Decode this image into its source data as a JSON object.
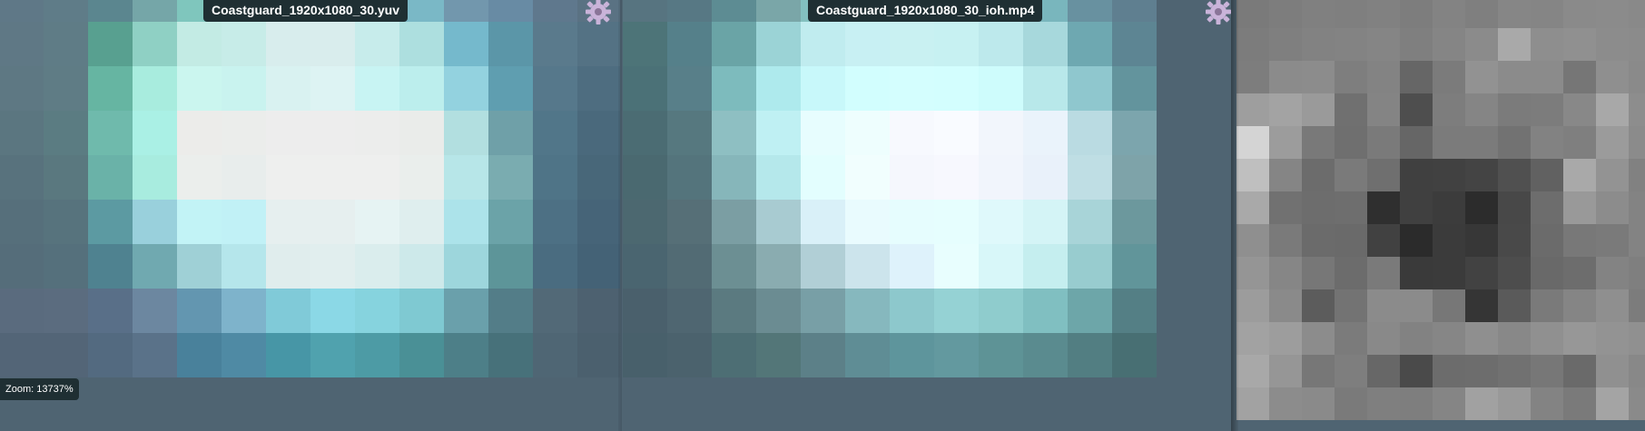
{
  "views": [
    {
      "title": "Coastguard_1920x1080_30.yuv",
      "rows": [
        [
          "#5f7887",
          "#5f7c88",
          "#5b868f",
          "#75a6a8",
          "#7fc6bd",
          "#8dd8cf",
          "#97dfdb",
          "#96dcdd",
          "#8bd1dc",
          "#7ab8c6",
          "#7297ad",
          "#688ba4",
          "#5f788d",
          "#5a7283"
        ],
        [
          "#5f7885",
          "#5f7c86",
          "#58a090",
          "#8fd0c4",
          "#c3ebe4",
          "#c7ece8",
          "#d8eded",
          "#d9eded",
          "#c7eceb",
          "#addfdf",
          "#75b9cc",
          "#5b96a8",
          "#5a7a8c",
          "#547284"
        ],
        [
          "#5e7883",
          "#5f7c85",
          "#66b5a2",
          "#a8ecde",
          "#cbf6ef",
          "#c9f3ef",
          "#d9f2f1",
          "#ddf3f3",
          "#c8f4f3",
          "#bceeed",
          "#93d2df",
          "#5f9eb0",
          "#56788b",
          "#4e6d80"
        ],
        [
          "#5b7680",
          "#5b7c82",
          "#6fbaac",
          "#aaf0e5",
          "#ececea",
          "#ebedeb",
          "#ededed",
          "#ededed",
          "#ecedec",
          "#eaecea",
          "#b2dfe0",
          "#6fa0a8",
          "#517689",
          "#4a697c"
        ],
        [
          "#58727d",
          "#5a787f",
          "#6ab2a8",
          "#a8ecdf",
          "#ebeeec",
          "#e8edec",
          "#eeefee",
          "#eeefee",
          "#eeefee",
          "#eaeeec",
          "#b7e6e8",
          "#7aacb0",
          "#4f7487",
          "#486779"
        ],
        [
          "#566f7b",
          "#57737d",
          "#5c9aa2",
          "#99d0dc",
          "#c2f3f6",
          "#c1f1f6",
          "#e6efef",
          "#e6efef",
          "#e6f3f3",
          "#dfeeee",
          "#ace3ea",
          "#6ba3a8",
          "#4d7084",
          "#466478"
        ],
        [
          "#556d7a",
          "#55707c",
          "#4f8290",
          "#70a9b0",
          "#9fd0d6",
          "#b5e6eb",
          "#e0eded",
          "#e1eeee",
          "#daeded",
          "#cde9ea",
          "#9dd6dc",
          "#5d9599",
          "#4a6c80",
          "#446276"
        ],
        [
          "#5a6b7e",
          "#5b6c7f",
          "#596f88",
          "#6c87a0",
          "#6396b0",
          "#7eb3cb",
          "#80cad8",
          "#8bd8e6",
          "#86d3de",
          "#7fc9d2",
          "#6aa0ab",
          "#537d88",
          "#526977",
          "#4d6170"
        ],
        [
          "#536577",
          "#536577",
          "#536a80",
          "#5a7289",
          "#49819b",
          "#4f8aa4",
          "#4796a6",
          "#50a2ae",
          "#4d9ba5",
          "#4a9096",
          "#4d7f88",
          "#47717a",
          "#4f6674",
          "#4b606e"
        ]
      ]
    },
    {
      "title": "Coastguard_1920x1080_30_ioh.mp4",
      "rows": [
        [
          "#577480",
          "#577884",
          "#5d8c93",
          "#7aa6a8",
          "#83c0c0",
          "#9edcdb",
          "#9ddedc",
          "#a1e0de",
          "#8ed3d2",
          "#79b6bd",
          "#6891a0",
          "#5f7f90"
        ],
        [
          "#4d7478",
          "#55808a",
          "#6aa4a6",
          "#9bd3d6",
          "#c0ecef",
          "#c8f0f3",
          "#c9f1f2",
          "#c7f1f2",
          "#bde9ec",
          "#a7d8dc",
          "#6ea8b1",
          "#5d8593"
        ],
        [
          "#4b7177",
          "#587f89",
          "#7dbbbd",
          "#aeeaed",
          "#c8f8fa",
          "#d2fefe",
          "#d4fefe",
          "#d3fefe",
          "#cefcfc",
          "#b8e8ea",
          "#8fc7ce",
          "#63949d"
        ],
        [
          "#4b6c73",
          "#56787f",
          "#8ebfc2",
          "#bff0f3",
          "#e7fdfe",
          "#eefefe",
          "#f7f9fe",
          "#f9fbff",
          "#f2f6fc",
          "#eaf3fb",
          "#badbe2",
          "#7ca5ad"
        ],
        [
          "#4a6970",
          "#54747c",
          "#86b6ba",
          "#b5e8eb",
          "#e3fefe",
          "#f1fefe",
          "#f5f7fd",
          "#f7f8fe",
          "#f1f5fc",
          "#e9f1fa",
          "#bfdee4",
          "#7ea3a9"
        ],
        [
          "#4c6870",
          "#566f77",
          "#7b9ea3",
          "#a8cbd1",
          "#d9f0f8",
          "#e9fbfe",
          "#e6fdfe",
          "#e6fefe",
          "#dff9fb",
          "#d4f4f6",
          "#a8d4d8",
          "#6c989d"
        ],
        [
          "#4a6570",
          "#526b74",
          "#6c8f93",
          "#8aacb0",
          "#b1cfd6",
          "#cce4ec",
          "#def2fb",
          "#e8fefe",
          "#d8f7f9",
          "#c5eeef",
          "#98cccf",
          "#61959a"
        ],
        [
          "#4a606c",
          "#4f6671",
          "#5b7a80",
          "#6b8c92",
          "#789fa6",
          "#86b8be",
          "#8dc8cc",
          "#95d2d4",
          "#8fcccd",
          "#80bfc1",
          "#6da6a9",
          "#547f85"
        ],
        [
          "#48606b",
          "#4b626d",
          "#4d6e74",
          "#537678",
          "#5c8088",
          "#5f8d95",
          "#5e959c",
          "#63999f",
          "#5e9396",
          "#5a8b8f",
          "#527e82",
          "#486f73"
        ]
      ]
    },
    {
      "title": "",
      "rows": [
        [
          "#7a7a7a",
          "#7d7d7d",
          "#808080",
          "#7f7f7f",
          "#818181",
          "#7d7d7d",
          "#838383",
          "#7f7f7f",
          "#868686",
          "#858585",
          "#8a8a8a",
          "#8b8b8b",
          "#898989",
          "#858585"
        ],
        [
          "#7c7c7c",
          "#7f7f7f",
          "#828282",
          "#838383",
          "#858585",
          "#7f7f7f",
          "#858585",
          "#8b8b8b",
          "#a9a9a9",
          "#8e8e8e",
          "#909090",
          "#8c8c8c",
          "#8b8b8b",
          "#888888"
        ],
        [
          "#7d7d7d",
          "#8b8b8b",
          "#8c8c8c",
          "#7e7e7e",
          "#838383",
          "#666666",
          "#7b7b7b",
          "#929292",
          "#8b8b8b",
          "#8b8b8b",
          "#767676",
          "#8f8f8f",
          "#8a8a8a",
          "#888888"
        ],
        [
          "#9e9e9e",
          "#a3a3a3",
          "#9a9a9a",
          "#707070",
          "#848484",
          "#4e4e4e",
          "#7d7d7d",
          "#858585",
          "#7b7b7b",
          "#7c7c7c",
          "#888888",
          "#a8a8a8",
          "#8d8d8d",
          "#8a8a8a"
        ],
        [
          "#d4d4d4",
          "#9c9c9c",
          "#797979",
          "#6f6f6f",
          "#7a7a7a",
          "#666666",
          "#7b7b7b",
          "#7b7b7b",
          "#727272",
          "#828282",
          "#7f7f7f",
          "#9b9b9b",
          "#8b8b8b",
          "#8b8b8b"
        ],
        [
          "#bfbfbf",
          "#858585",
          "#6c6c6c",
          "#7a7a7a",
          "#6f6f6f",
          "#404040",
          "#414141",
          "#444444",
          "#505050",
          "#616161",
          "#a9a9a9",
          "#939393",
          "#818181",
          "#7d7d7d"
        ],
        [
          "#a9a9a9",
          "#717171",
          "#6d6d6d",
          "#6e6e6e",
          "#2f2f2f",
          "#404040",
          "#3c3c3c",
          "#2c2c2c",
          "#484848",
          "#6d6d6d",
          "#999999",
          "#8c8c8c",
          "#838383",
          "#848484"
        ],
        [
          "#8f8f8f",
          "#7a7a7a",
          "#6b6b6b",
          "#6a6a6a",
          "#414141",
          "#2b2b2b",
          "#3b3b3b",
          "#373737",
          "#494949",
          "#6b6b6b",
          "#787878",
          "#7a7a7a",
          "#838383",
          "#828282"
        ],
        [
          "#959595",
          "#868686",
          "#777777",
          "#6c6c6c",
          "#7a7a7a",
          "#3a3a3a",
          "#3b3b3b",
          "#424242",
          "#4d4d4d",
          "#696969",
          "#6d6d6d",
          "#838383",
          "#7f7f7f",
          "#7e7e7e"
        ],
        [
          "#9c9c9c",
          "#8a8a8a",
          "#5c5c5c",
          "#737373",
          "#8b8b8b",
          "#8b8b8b",
          "#777777",
          "#353535",
          "#5a5a5a",
          "#7a7a7a",
          "#858585",
          "#8f8f8f",
          "#7c7c7c",
          "#6b6b6b"
        ],
        [
          "#a2a2a2",
          "#9d9d9d",
          "#8c8c8c",
          "#7b7b7b",
          "#898989",
          "#828282",
          "#868686",
          "#8f8f8f",
          "#888888",
          "#909090",
          "#979797",
          "#939393",
          "#909090",
          "#6a6a6a"
        ],
        [
          "#a8a8a8",
          "#969696",
          "#777777",
          "#7e7e7e",
          "#676767",
          "#4a4a4a",
          "#6c6c6c",
          "#6d6d6d",
          "#717171",
          "#777777",
          "#6a6a6a",
          "#909090",
          "#888888",
          "#737373"
        ],
        [
          "#a2a2a2",
          "#8c8c8c",
          "#8a8a8a",
          "#7a7a7a",
          "#7f7f7f",
          "#7e7e7e",
          "#858585",
          "#a1a1a1",
          "#999999",
          "#838383",
          "#7a7a7a",
          "#a4a4a4",
          "#8a8a8a",
          "#747474"
        ]
      ]
    }
  ],
  "zoom_label": "Zoom: 13737%",
  "settings_icon": "gear-icon",
  "colors": {
    "badge_bg": "#1f2f33",
    "badge_text": "#ffffff",
    "gear": "#c9b3d9"
  }
}
